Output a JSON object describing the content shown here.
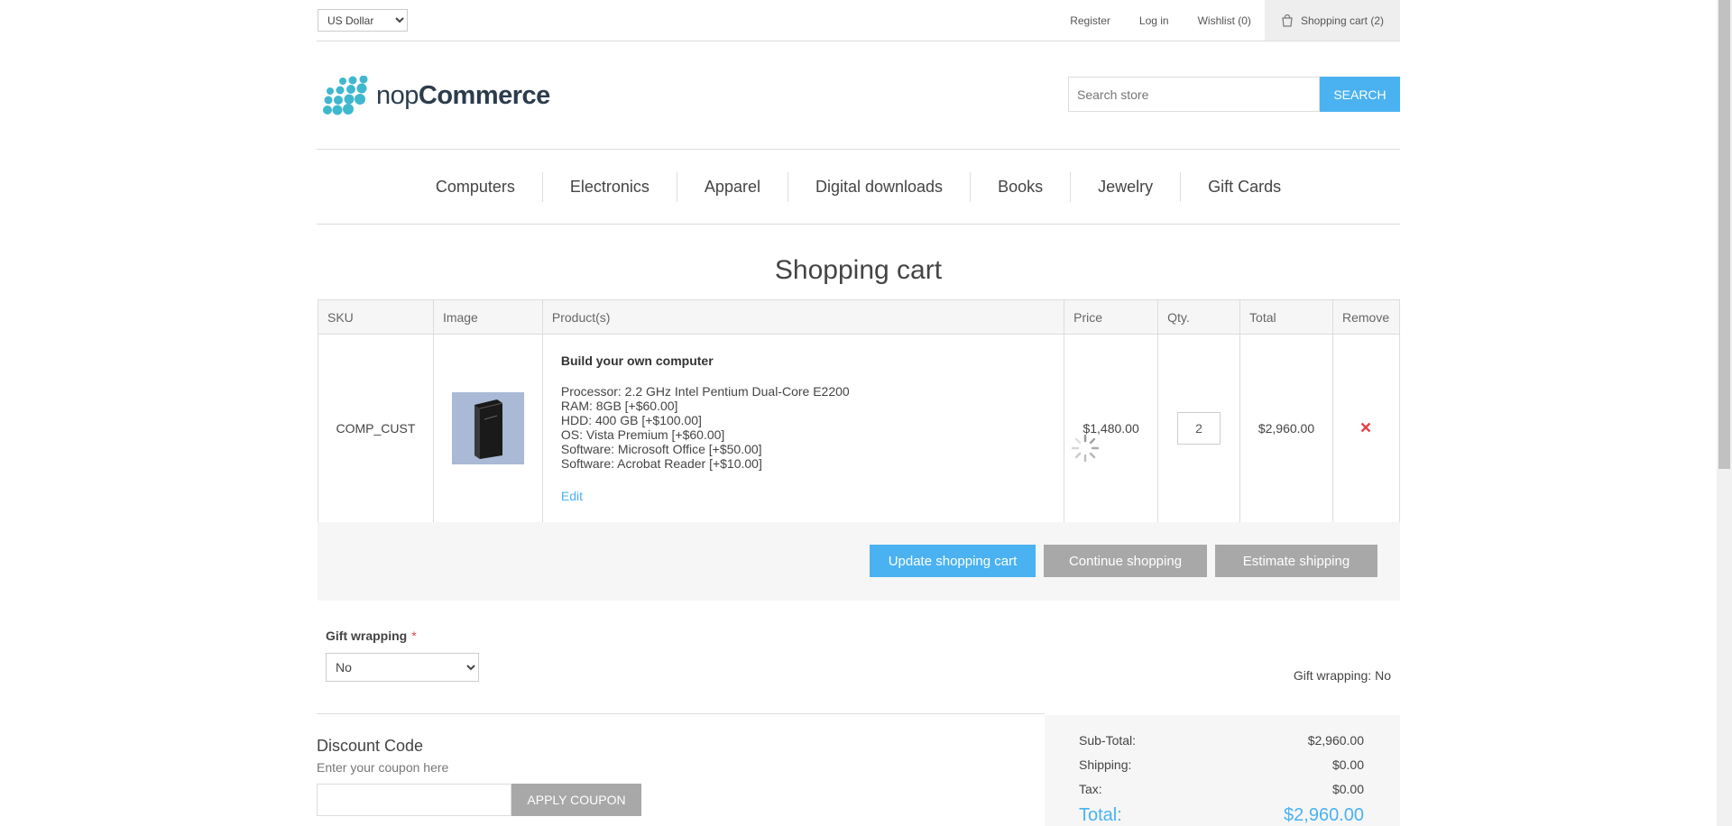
{
  "header": {
    "currency": "US Dollar",
    "links": {
      "register": "Register",
      "login": "Log in",
      "wishlist": "Wishlist (0)",
      "cart": "Shopping cart (2)"
    }
  },
  "logo": {
    "light": "nop",
    "bold": "Commerce"
  },
  "search": {
    "placeholder": "Search store",
    "button": "SEARCH"
  },
  "menu": [
    "Computers",
    "Electronics",
    "Apparel",
    "Digital downloads",
    "Books",
    "Jewelry",
    "Gift Cards"
  ],
  "page_title": "Shopping cart",
  "table": {
    "headers": {
      "sku": "SKU",
      "image": "Image",
      "product": "Product(s)",
      "price": "Price",
      "qty": "Qty.",
      "total": "Total",
      "remove": "Remove"
    },
    "row": {
      "sku": "COMP_CUST",
      "name": "Build your own computer",
      "attributes": [
        "Processor: 2.2 GHz Intel Pentium Dual-Core E2200",
        "RAM: 8GB [+$60.00]",
        "HDD: 400 GB [+$100.00]",
        "OS: Vista Premium [+$60.00]",
        "Software: Microsoft Office [+$50.00]",
        "Software: Acrobat Reader [+$10.00]"
      ],
      "edit": "Edit",
      "price": "$1,480.00",
      "qty": "2",
      "total": "$2,960.00"
    }
  },
  "buttons": {
    "update": "Update shopping cart",
    "continue": "Continue shopping",
    "estimate": "Estimate shipping"
  },
  "gift": {
    "label": "Gift wrapping",
    "required": "*",
    "selected": "No",
    "info": "Gift wrapping: No"
  },
  "discount": {
    "title": "Discount Code",
    "hint": "Enter your coupon here",
    "button": "APPLY COUPON"
  },
  "totals": {
    "subtotal_label": "Sub-Total:",
    "subtotal": "$2,960.00",
    "shipping_label": "Shipping:",
    "shipping": "$0.00",
    "tax_label": "Tax:",
    "tax": "$0.00",
    "total_label": "Total:",
    "total": "$2,960.00"
  },
  "colors": {
    "accent": "#4ab2f1",
    "secondary_button": "#a8a8a8",
    "remove": "#e4434b"
  }
}
